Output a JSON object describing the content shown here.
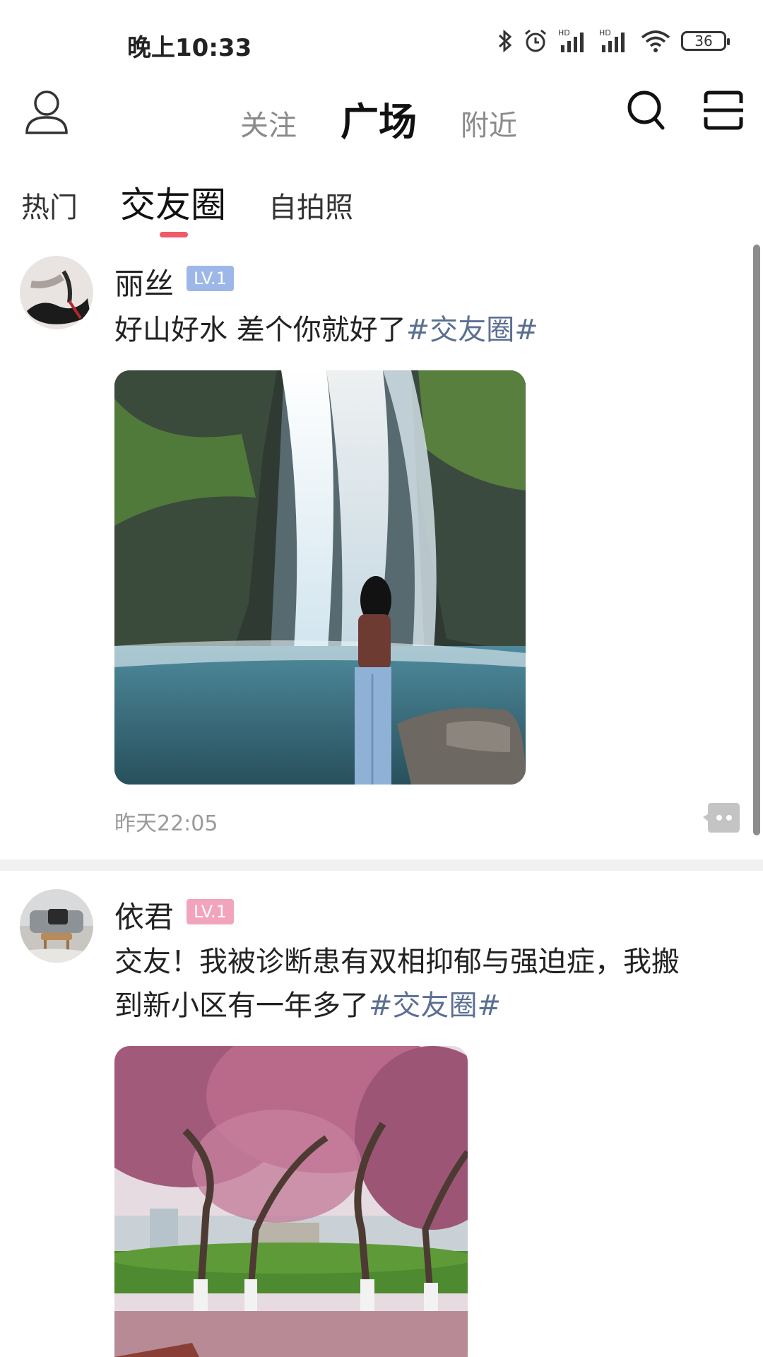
{
  "status_bar": {
    "time": "晚上10:33",
    "icons": [
      "bluetooth-icon",
      "alarm-icon",
      "hd-signal-icon",
      "hd-signal-icon",
      "wifi-icon",
      "battery-icon"
    ],
    "hd_label": "HD",
    "battery": "36"
  },
  "top_nav": {
    "tabs": [
      "关注",
      "广场",
      "附近"
    ],
    "active_tab": "广场",
    "left_icon": "user-icon",
    "right_icons": [
      "search-icon",
      "scan-icon"
    ]
  },
  "sub_tabs": {
    "items": [
      "热门",
      "交友圈",
      "自拍照"
    ],
    "active": "交友圈",
    "indicator_color": "#ef5a66"
  },
  "posts": [
    {
      "username": "丽丝",
      "level": "LV.1",
      "level_color": "#9db7e8",
      "text": "好山好水 差个你就好了",
      "tag": "#交友圈#",
      "time": "昨天22:05",
      "image": "waterfall-photo"
    },
    {
      "username": "依君",
      "level": "LV.1",
      "level_color": "#f3a4bd",
      "text_line1": "交友！我被诊断患有双相抑郁与强迫症，我搬",
      "text_line2": "到新小区有一年多了",
      "tag": "#交友圈#",
      "image": "cherry-blossom-photo"
    }
  ],
  "colors": {
    "tag": "#5b6f93",
    "divider": "#f1f1f1"
  }
}
